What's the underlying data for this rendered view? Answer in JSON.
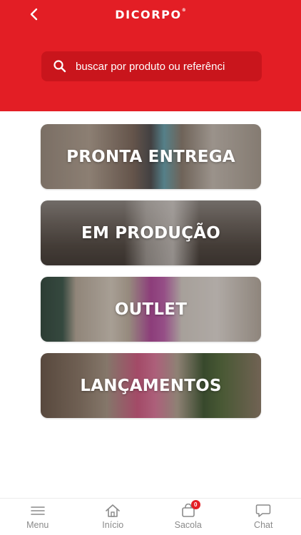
{
  "header": {
    "brand": "DICORPO",
    "brand_mark": "®",
    "back_icon": "chevron-left-icon",
    "background_color": "#e31e25"
  },
  "search": {
    "placeholder": "buscar por produto ou referênci",
    "icon": "search-icon"
  },
  "categories": [
    {
      "label": "PRONTA ENTREGA"
    },
    {
      "label": "EM PRODUÇÃO"
    },
    {
      "label": "OUTLET"
    },
    {
      "label": "LANÇAMENTOS"
    }
  ],
  "bottom_nav": {
    "items": [
      {
        "label": "Menu",
        "icon": "hamburger-menu-icon"
      },
      {
        "label": "Início",
        "icon": "home-icon"
      },
      {
        "label": "Sacola",
        "icon": "shopping-bag-icon",
        "badge": "0"
      },
      {
        "label": "Chat",
        "icon": "chat-bubble-icon"
      }
    ]
  }
}
